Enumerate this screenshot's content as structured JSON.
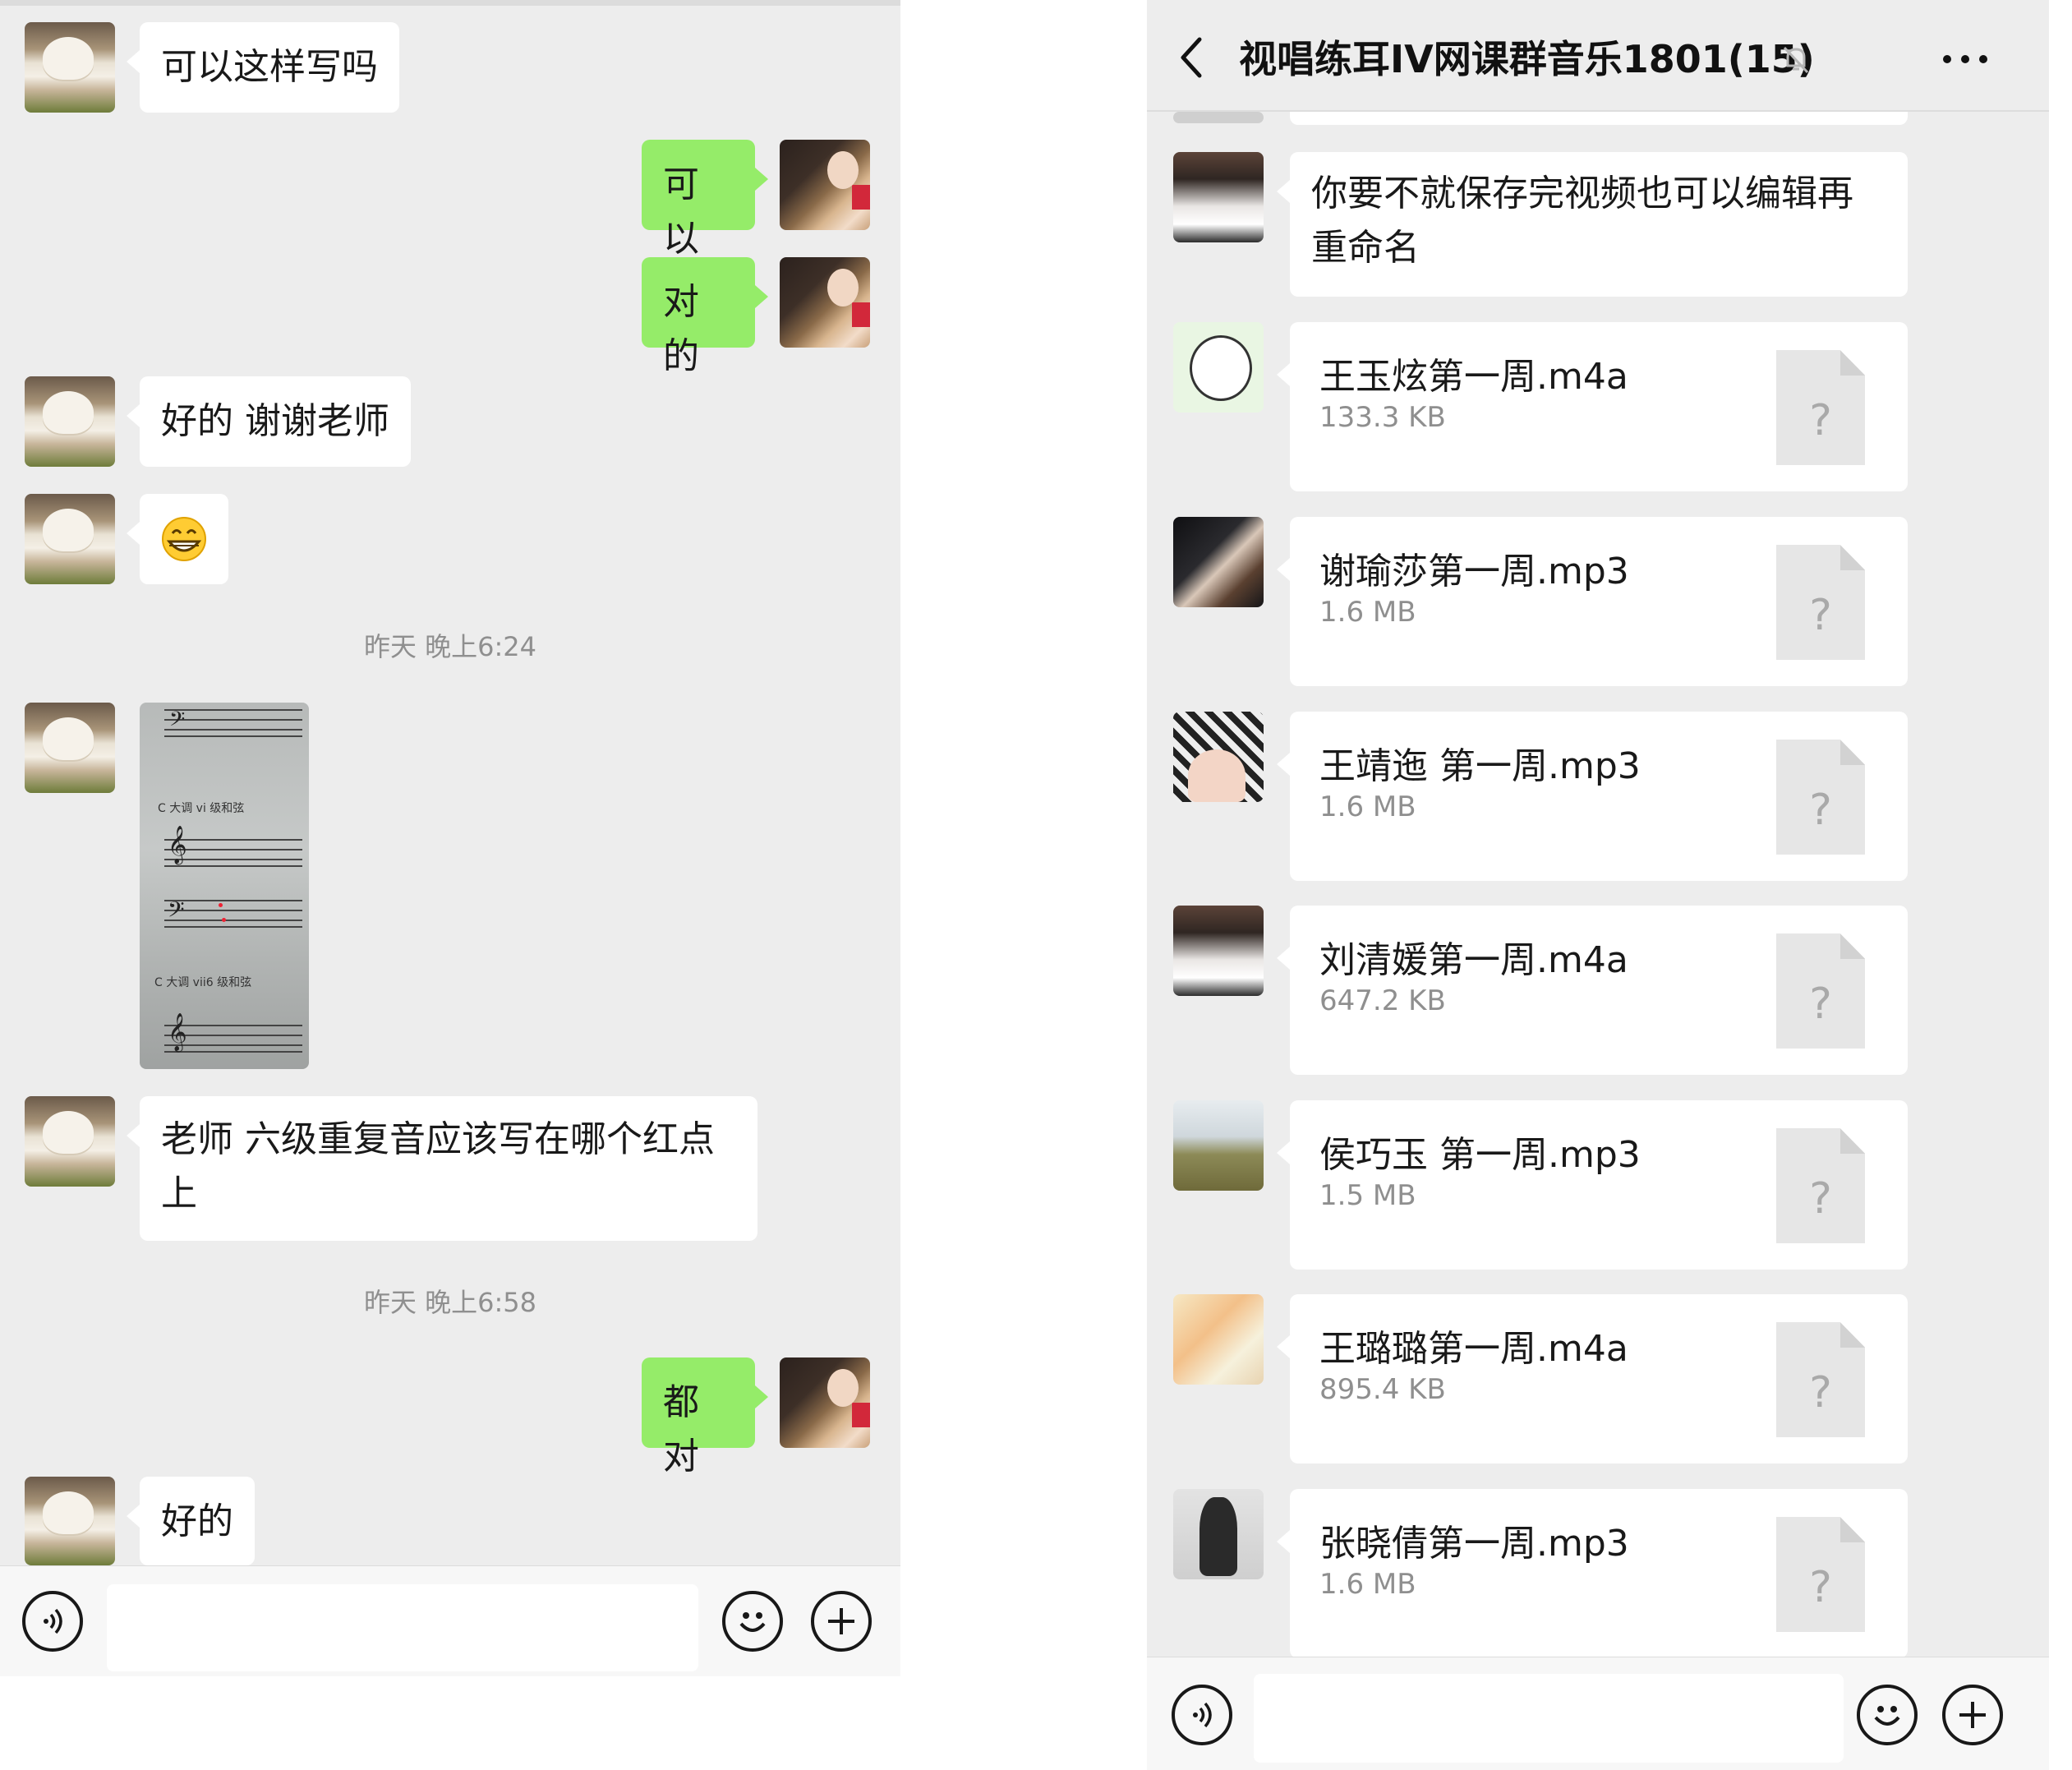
{
  "left_chat": {
    "messages": [
      {
        "side": "left",
        "text": "可以这样写吗"
      },
      {
        "side": "right",
        "text": "可以"
      },
      {
        "side": "right",
        "text": "对的"
      },
      {
        "side": "left",
        "text": "好的 谢谢老师"
      },
      {
        "side": "left",
        "emoji": "grinning-face"
      },
      {
        "timestamp": "昨天 晚上6:24"
      },
      {
        "side": "left",
        "image": "sheet-music-photo",
        "captions": [
          "C 大调 vi 级和弦",
          "C 大调 vii6 级和弦"
        ]
      },
      {
        "side": "left",
        "text_lines": [
          "老师 六级重复音应该写在哪个红点",
          "上"
        ]
      },
      {
        "timestamp": "昨天 晚上6:58"
      },
      {
        "side": "right",
        "text": "都对"
      },
      {
        "side": "left",
        "text": "好的"
      }
    ],
    "input": {
      "value": "",
      "icons": [
        "voice-icon",
        "emoji-icon",
        "plus-icon"
      ]
    }
  },
  "right_chat": {
    "title": "视唱练耳IV网课群音乐1801(15)",
    "header_icons": [
      "back-icon",
      "mute-bell-icon",
      "more-icon"
    ],
    "text_message_lines": [
      "你要不就保存完视频也可以编辑再",
      "重命名"
    ],
    "files": [
      {
        "name": "王玉炫第一周.m4a",
        "size": "133.3 KB"
      },
      {
        "name": "谢瑜莎第一周.mp3",
        "size": "1.6 MB"
      },
      {
        "name": "王靖迤 第一周.mp3",
        "size": "1.6 MB"
      },
      {
        "name": "刘清媛第一周.m4a",
        "size": "647.2 KB"
      },
      {
        "name": "侯巧玉 第一周.mp3",
        "size": "1.5 MB"
      },
      {
        "name": "王璐璐第一周.m4a",
        "size": "895.4 KB"
      },
      {
        "name": "张晓倩第一周.mp3",
        "size": "1.6 MB"
      }
    ],
    "unknown_file_glyph": "?",
    "input": {
      "value": "",
      "icons": [
        "voice-icon",
        "emoji-icon",
        "plus-icon"
      ]
    }
  },
  "colors": {
    "chat_bg": "#ededed",
    "sent_bubble": "#95ec69",
    "received_bubble": "#ffffff",
    "timestamp_text": "#8f8f8f"
  }
}
